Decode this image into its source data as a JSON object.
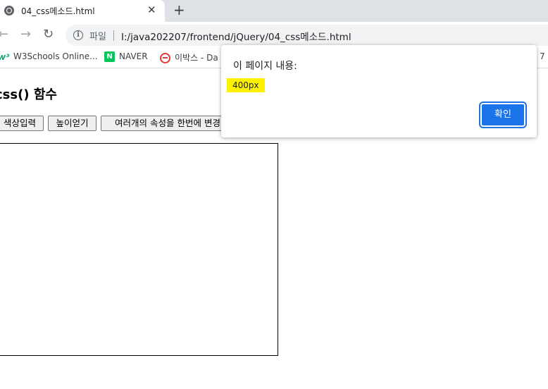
{
  "browser": {
    "tab": {
      "title": "04_css메소드.html",
      "favicon": "globe-icon",
      "close_glyph": "✕"
    },
    "new_tab_glyph": "+",
    "nav": {
      "back": "←",
      "forward": "→",
      "reload": "↻"
    },
    "omnibox": {
      "info_glyph": "i",
      "scheme_label": "파일",
      "url": "I:/java202207/frontend/jQuery/04_css메소드.html"
    },
    "bookmarks": [
      {
        "icon": "w3schools-icon",
        "glyph": "w³",
        "label": "W3Schools Online..."
      },
      {
        "icon": "naver-icon",
        "glyph": "N",
        "label": "NAVER"
      },
      {
        "icon": "ebox-icon",
        "glyph": "",
        "label": "이박스 - Da"
      }
    ],
    "bookmarks_overflow": "7"
  },
  "page": {
    "heading": "css() 함수",
    "buttons": [
      {
        "label": "색상입력"
      },
      {
        "label": "높이얻기"
      },
      {
        "label": "여러개의 속성을 한번에 변경"
      }
    ]
  },
  "dialog": {
    "title": "이 페이지 내용:",
    "message": "400px",
    "ok_label": "확인",
    "highlight_color": "#fff200",
    "accent_color": "#1a73e8"
  }
}
